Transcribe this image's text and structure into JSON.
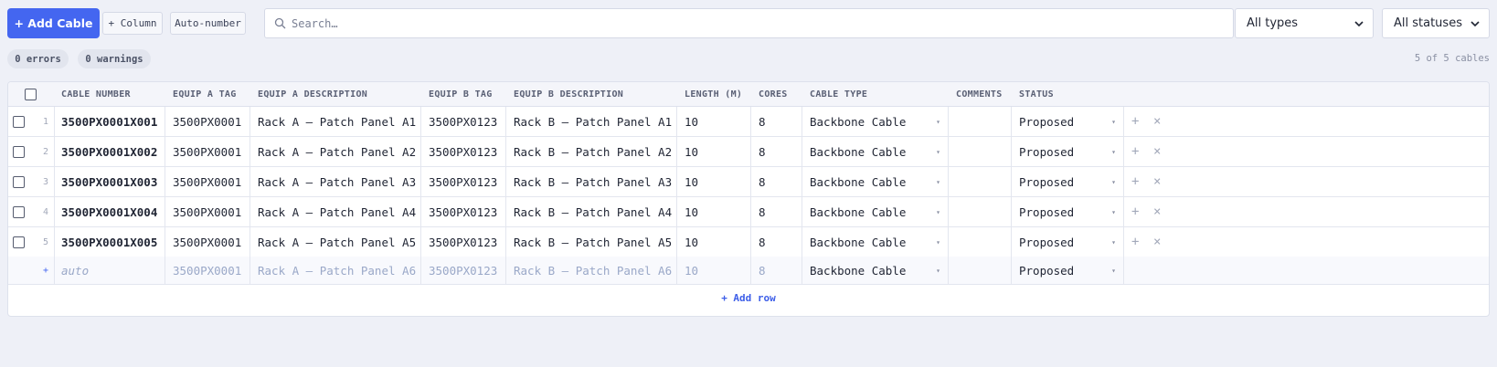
{
  "toolbar": {
    "add_cable": "+ Add Cable",
    "add_column": "+ Column",
    "auto_number": "Auto-number",
    "search_placeholder": "Search…",
    "type_filter": "All types",
    "status_filter": "All statuses"
  },
  "summary": {
    "errors": "0 errors",
    "warnings": "0 warnings",
    "count": "5 of 5 cables"
  },
  "columns": [
    "CABLE NUMBER",
    "EQUIP A TAG",
    "EQUIP A DESCRIPTION",
    "EQUIP B TAG",
    "EQUIP B DESCRIPTION",
    "LENGTH (M)",
    "CORES",
    "CABLE TYPE",
    "COMMENTS",
    "STATUS"
  ],
  "rows": [
    {
      "num": "1",
      "cable": "3500PX0001X001",
      "a_tag": "3500PX0001",
      "a_desc": "Rack A – Patch Panel A1",
      "b_tag": "3500PX0123",
      "b_desc": "Rack B – Patch Panel A1",
      "length": "10",
      "cores": "8",
      "type": "Backbone Cable",
      "comments": "",
      "status": "Proposed"
    },
    {
      "num": "2",
      "cable": "3500PX0001X002",
      "a_tag": "3500PX0001",
      "a_desc": "Rack A – Patch Panel A2",
      "b_tag": "3500PX0123",
      "b_desc": "Rack B – Patch Panel A2",
      "length": "10",
      "cores": "8",
      "type": "Backbone Cable",
      "comments": "",
      "status": "Proposed"
    },
    {
      "num": "3",
      "cable": "3500PX0001X003",
      "a_tag": "3500PX0001",
      "a_desc": "Rack A – Patch Panel A3",
      "b_tag": "3500PX0123",
      "b_desc": "Rack B – Patch Panel A3",
      "length": "10",
      "cores": "8",
      "type": "Backbone Cable",
      "comments": "",
      "status": "Proposed"
    },
    {
      "num": "4",
      "cable": "3500PX0001X004",
      "a_tag": "3500PX0001",
      "a_desc": "Rack A – Patch Panel A4",
      "b_tag": "3500PX0123",
      "b_desc": "Rack B – Patch Panel A4",
      "length": "10",
      "cores": "8",
      "type": "Backbone Cable",
      "comments": "",
      "status": "Proposed"
    },
    {
      "num": "5",
      "cable": "3500PX0001X005",
      "a_tag": "3500PX0001",
      "a_desc": "Rack A – Patch Panel A5",
      "b_tag": "3500PX0123",
      "b_desc": "Rack B – Patch Panel A5",
      "length": "10",
      "cores": "8",
      "type": "Backbone Cable",
      "comments": "",
      "status": "Proposed"
    }
  ],
  "new_row": {
    "num": "+",
    "cable": "auto",
    "a_tag": "3500PX0001",
    "a_desc": "Rack A – Patch Panel A6",
    "b_tag": "3500PX0123",
    "b_desc": "Rack B – Patch Panel A6",
    "length": "10",
    "cores": "8",
    "type": "Backbone Cable",
    "status": "Proposed"
  },
  "add_row": "+ Add row",
  "icons": {
    "search": "search-icon",
    "chevron": "chevron-down-icon",
    "add": "plus-icon",
    "remove": "close-icon"
  },
  "colors": {
    "accent": "#4466f0",
    "link": "#3d5ee8",
    "background": "#eef0f7"
  }
}
